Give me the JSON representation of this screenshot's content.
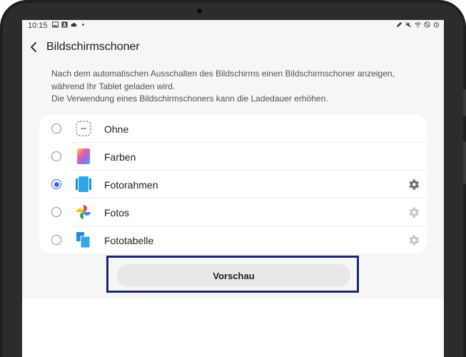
{
  "status_bar": {
    "time": "10:15",
    "left_icons": [
      "image-icon",
      "contact-card-icon",
      "cloud-icon",
      "dot-icon"
    ],
    "right_icons": [
      "pen-icon",
      "mute-icon",
      "wifi-icon",
      "dnd-icon",
      "alarm-icon"
    ]
  },
  "header": {
    "back_icon": "back-arrow-icon",
    "title": "Bildschirmschoner"
  },
  "description": {
    "line1": "Nach dem automatischen Ausschalten des Bildschirms einen Bildschirmschoner anzeigen,",
    "line2": "während Ihr Tablet geladen wird.",
    "line3": "Die Verwendung eines Bildschirmschoners kann die Ladedauer erhöhen."
  },
  "options": [
    {
      "label": "Ohne",
      "icon": "none-dashed-icon",
      "selected": false,
      "gear": "none"
    },
    {
      "label": "Farben",
      "icon": "gradient-colors-icon",
      "selected": false,
      "gear": "none"
    },
    {
      "label": "Fotorahmen",
      "icon": "photo-frame-icon",
      "selected": true,
      "gear": "active"
    },
    {
      "label": "Fotos",
      "icon": "google-photos-icon",
      "selected": false,
      "gear": "disabled"
    },
    {
      "label": "Fototabelle",
      "icon": "photo-table-icon",
      "selected": false,
      "gear": "disabled"
    }
  ],
  "preview_button": {
    "label": "Vorschau"
  },
  "colors": {
    "accent": "#2f6fdb",
    "highlight_border": "#1d2673",
    "gear_active": "#6e6e6e",
    "gear_disabled": "#c8c8c8"
  }
}
